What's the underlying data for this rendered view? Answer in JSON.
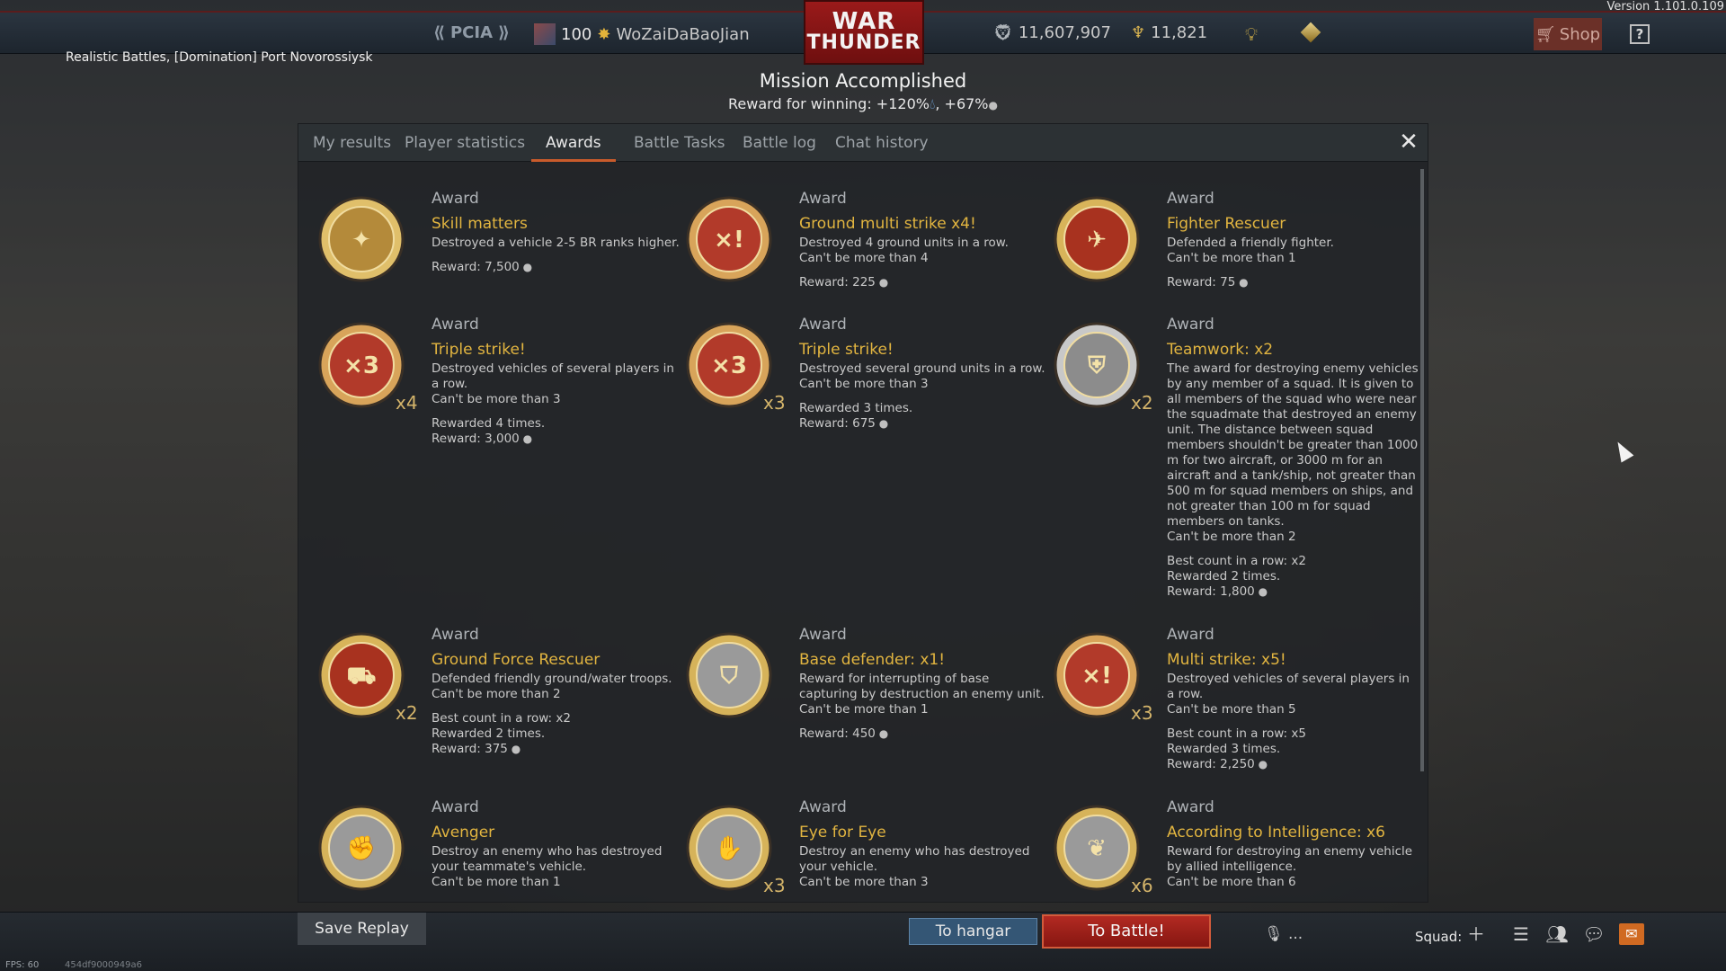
{
  "version": "Version 1.101.0.109",
  "topbar": {
    "rank_text": "PCIA",
    "player_level": "100",
    "player_name": "WoZaiDaBaoJian",
    "silver_lions": "11,607,907",
    "golden_eagles": "11,821",
    "shop_label": "Shop",
    "help_label": "?",
    "logo_line1": "WAR",
    "logo_line2": "THUNDER"
  },
  "mission": {
    "label": "Realistic Battles, [Domination] Port Novorossiysk",
    "title": "Mission Accomplished",
    "reward_prefix": "Reward for winning: +120%",
    "reward_suffix": ", +67%"
  },
  "tabs": [
    "My results",
    "Player statistics",
    "Awards",
    "Battle Tasks",
    "Battle log",
    "Chat history"
  ],
  "active_tab": "Awards",
  "awards": [
    {
      "kind": "Award",
      "name": "Skill matters",
      "desc": [
        "Destroyed a vehicle 2-5 BR ranks higher."
      ],
      "details": [
        "Reward: 7,500"
      ],
      "count": "",
      "icon": "skill-matters-medal-icon"
    },
    {
      "kind": "Award",
      "name": "Ground multi strike x4!",
      "desc": [
        "Destroyed 4 ground units in a row.",
        "Can't be more than 4"
      ],
      "details": [
        "Reward: 225"
      ],
      "count": "",
      "icon": "ground-multi-strike-medal-icon"
    },
    {
      "kind": "Award",
      "name": "Fighter Rescuer",
      "desc": [
        "Defended a friendly fighter.",
        "Can't be more than 1"
      ],
      "details": [
        "Reward: 75"
      ],
      "count": "",
      "icon": "fighter-rescuer-medal-icon"
    },
    {
      "kind": "Award",
      "name": "Triple strike!",
      "desc": [
        "Destroyed vehicles of several players in a row.",
        "Can't be more than 3"
      ],
      "details": [
        "Rewarded 4 times.",
        "Reward: 3,000"
      ],
      "count": "x4",
      "icon": "triple-strike-medal-icon"
    },
    {
      "kind": "Award",
      "name": "Triple strike!",
      "desc": [
        "Destroyed several ground units in a row.",
        "Can't be more than 3"
      ],
      "details": [
        "Rewarded 3 times.",
        "Reward: 675"
      ],
      "count": "x3",
      "icon": "ground-triple-strike-medal-icon"
    },
    {
      "kind": "Award",
      "name": "Teamwork: x2",
      "desc": [
        "The award for destroying enemy vehicles by any member of a squad. It is given to all members of the squad who were near the squadmate that destroyed an enemy unit. The distance between squad members shouldn't be greater than 1000 m for two aircraft, or 3000 m for an aircraft and a tank/ship, not greater than 500 m for squad members on ships, and not greater than 100 m for squad members on tanks.",
        "Can't be more than 2"
      ],
      "details": [
        "Best count in a row: x2",
        "Rewarded 2 times.",
        "Reward: 1,800"
      ],
      "count": "x2",
      "icon": "teamwork-medal-icon"
    },
    {
      "kind": "Award",
      "name": "Ground Force Rescuer",
      "desc": [
        "Defended friendly ground/water troops.",
        "Can't be more than 2"
      ],
      "details": [
        "Best count in a row: x2",
        "Rewarded 2 times.",
        "Reward: 375"
      ],
      "count": "x2",
      "icon": "ground-force-rescuer-medal-icon"
    },
    {
      "kind": "Award",
      "name": "Base defender: x1!",
      "desc": [
        "Reward for interrupting of base capturing by destruction an enemy unit.",
        "Can't be more than 1"
      ],
      "details": [
        "Reward: 450"
      ],
      "count": "",
      "icon": "base-defender-medal-icon"
    },
    {
      "kind": "Award",
      "name": "Multi strike: x5!",
      "desc": [
        "Destroyed vehicles of several players in a row.",
        "Can't be more than 5"
      ],
      "details": [
        "Best count in a row: x5",
        "Rewarded 3 times.",
        "Reward: 2,250"
      ],
      "count": "x3",
      "icon": "multi-strike-medal-icon"
    },
    {
      "kind": "Award",
      "name": "Avenger",
      "desc": [
        "Destroy an enemy who has destroyed your teammate's vehicle.",
        "Can't be more than 1"
      ],
      "details": [],
      "count": "",
      "icon": "avenger-medal-icon"
    },
    {
      "kind": "Award",
      "name": "Eye for Eye",
      "desc": [
        "Destroy an enemy who has destroyed your vehicle.",
        "Can't be more than 3"
      ],
      "details": [],
      "count": "x3",
      "icon": "eye-for-eye-medal-icon"
    },
    {
      "kind": "Award",
      "name": "According to Intelligence: x6",
      "desc": [
        "Reward for destroying an enemy vehicle by allied intelligence.",
        "Can't be more than 6"
      ],
      "details": [],
      "count": "x6",
      "icon": "intelligence-medal-icon"
    }
  ],
  "bottombar": {
    "save_replay": "Save Replay",
    "to_hangar": "To hangar",
    "to_battle": "To Battle!",
    "voice": "...",
    "squad_label": "Squad:",
    "fps": "FPS: 60",
    "fps_code": "454df9000949a6"
  },
  "colors": {
    "accent": "#c95b2b",
    "award_name": "#e2b540",
    "battle_button": "#b22a22",
    "hangar_button": "#345675"
  }
}
